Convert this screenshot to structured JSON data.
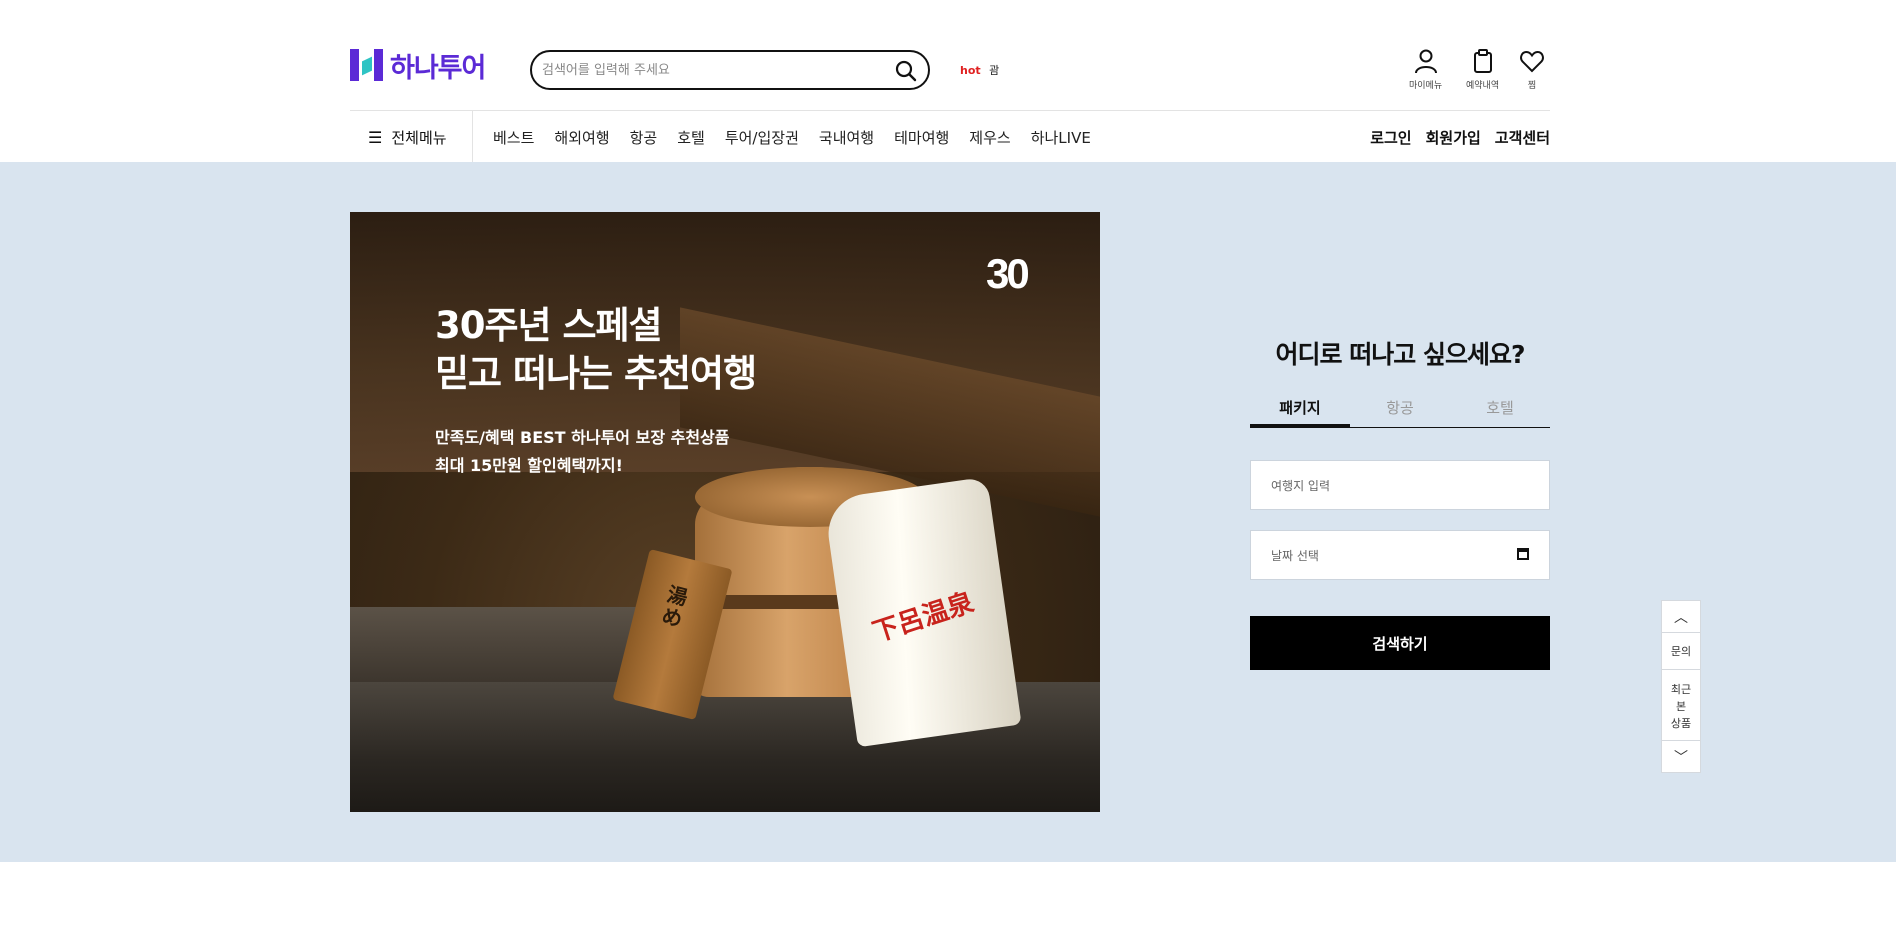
{
  "header": {
    "logo_text": "하나투어",
    "search_placeholder": "검색어를 입력해 주세요",
    "hot_tag": "hot",
    "hot_keyword": "괌",
    "util": {
      "mymenu": "마이메뉴",
      "reservations": "예약내역",
      "wishlist": "찜"
    }
  },
  "nav": {
    "all_menu": "전체메뉴",
    "items": [
      "베스트",
      "해외여행",
      "항공",
      "호텔",
      "투어/입장권",
      "국내여행",
      "테마여행",
      "제우스",
      "하나LIVE"
    ],
    "right": [
      "로그인",
      "회원가입",
      "고객센터"
    ]
  },
  "banner": {
    "title_line1": "30주년 스페셜",
    "title_line2": "믿고 떠나는 추천여행",
    "desc_line1": "만족도/혜택 BEST 하나투어 보장 추천상품",
    "desc_line2": "최대 15만원 할인혜택까지!",
    "badge": "30"
  },
  "search_panel": {
    "title": "어디로 떠나고 싶으세요?",
    "tabs": [
      "패키지",
      "항공",
      "호텔"
    ],
    "active_tab": "패키지",
    "destination_placeholder": "여행지 입력",
    "date_placeholder": "날짜 선택",
    "submit": "검색하기"
  },
  "quick_bar": {
    "inquiry": "문의",
    "recent": "최근\n본\n상품"
  },
  "colors": {
    "brand": "#5b2ad6",
    "brand_accent": "#2ec4c4",
    "hot": "#e02020",
    "main_bg": "#d9e4ef"
  }
}
